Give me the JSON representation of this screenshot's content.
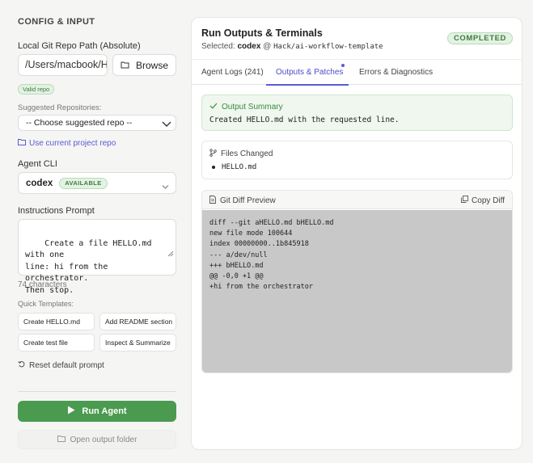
{
  "config": {
    "section_title": "CONFIG & INPUT",
    "repo_path_label": "Local Git Repo Path (Absolute)",
    "repo_path_value": "/Users/macbook/H",
    "browse_label": "Browse",
    "valid_badge": "Valid repo",
    "suggested_label": "Suggested Repositories:",
    "suggested_selected": "-- Choose suggested repo --",
    "use_current_label": "Use current project repo",
    "agent_cli_label": "Agent CLI",
    "agent_cli_value": "codex",
    "agent_cli_status": "AVAILABLE",
    "prompt_label": "Instructions Prompt",
    "prompt_value": "Create a file HELLO.md with one\nline: hi from the orchestrator.\nThen stop.",
    "char_count": "74 characters",
    "templates_label": "Quick Templates:",
    "templates": [
      "Create HELLO.md",
      "Add README section",
      "Create test file",
      "Inspect & Summarize"
    ],
    "reset_label": "Reset default prompt",
    "run_label": "Run Agent",
    "open_output_label": "Open output folder"
  },
  "run": {
    "title": "Run Outputs & Terminals",
    "selected_prefix": "Selected:",
    "selected_agent": "codex",
    "at": "@",
    "selected_repo": "Hack/ai-workflow-template",
    "status": "COMPLETED",
    "tabs": [
      "Agent Logs (241)",
      "Outputs & Patches",
      "Errors & Diagnostics"
    ],
    "active_tab": "Outputs & Patches",
    "summary_title": "Output Summary",
    "summary_text": "Created HELLO.md with the requested line.",
    "files_title": "Files Changed",
    "files": [
      "HELLO.md"
    ],
    "diff_title": "Git Diff Preview",
    "copy_label": "Copy Diff",
    "diff_text": "diff --git aHELLO.md bHELLO.md\nnew file mode 100644\nindex 00000000..1b845918\n--- a/dev/null\n+++ bHELLO.md\n@@ -0,0 +1 @@\n+hi from the orchestrator"
  },
  "colors": {
    "accent": "#5a5ad6",
    "success": "#4a9a50",
    "badge_bg": "#e3f2e3"
  }
}
